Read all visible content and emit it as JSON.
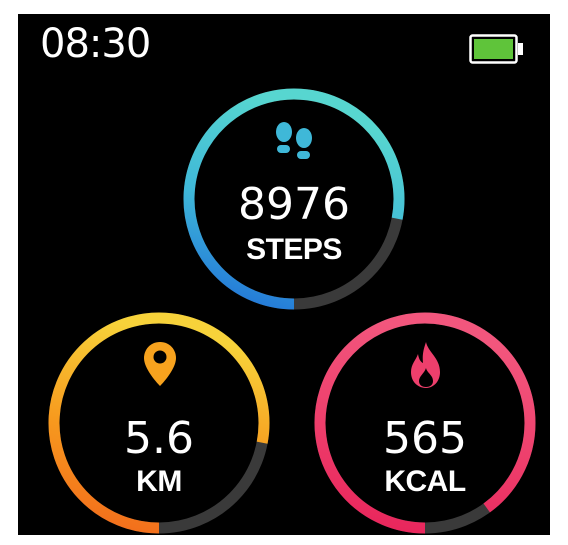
{
  "status": {
    "time": "08:30",
    "battery_icon": "battery-full-icon",
    "battery_color": "#5fc43a"
  },
  "rings": {
    "steps": {
      "value": "8976",
      "unit": "STEPS",
      "progress": 0.78,
      "icon": "footprints-icon",
      "colors": [
        "#1f6fd8",
        "#3fb8d8",
        "#57d6d0"
      ],
      "track_color": "#3a3a3a"
    },
    "distance": {
      "value": "5.6",
      "unit": "KM",
      "progress": 0.78,
      "icon": "location-pin-icon",
      "colors": [
        "#f26a1b",
        "#f79a1e",
        "#f7d23a"
      ],
      "track_color": "#3a3a3a"
    },
    "calories": {
      "value": "565",
      "unit": "KCAL",
      "progress": 0.9,
      "icon": "flame-icon",
      "colors": [
        "#e8235a",
        "#ee3f6c",
        "#f2567d"
      ],
      "track_color": "#3a3a3a"
    }
  }
}
